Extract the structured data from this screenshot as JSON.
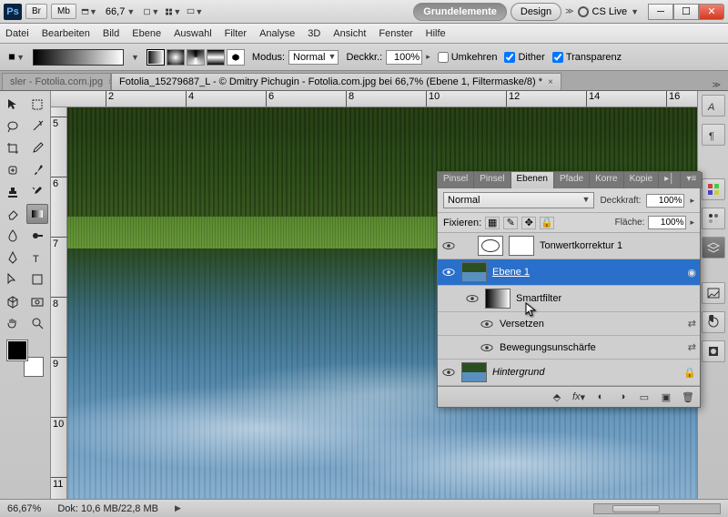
{
  "title": {
    "zoom": "66,7",
    "ws_active": "Grundelemente",
    "ws_other": "Design",
    "cslive": "CS Live"
  },
  "menu": [
    "Datei",
    "Bearbeiten",
    "Bild",
    "Ebene",
    "Auswahl",
    "Filter",
    "Analyse",
    "3D",
    "Ansicht",
    "Fenster",
    "Hilfe"
  ],
  "options": {
    "mode_label": "Modus:",
    "mode_value": "Normal",
    "opacity_label": "Deckkr.:",
    "opacity_value": "100%",
    "reverse": "Umkehren",
    "dither": "Dither",
    "trans": "Transparenz"
  },
  "tabs": {
    "inactive": "sler - Fotolia.com.jpg",
    "active": "Fotolia_15279687_L - © Dmitry Pichugin - Fotolia.com.jpg bei 66,7% (Ebene 1, Filtermaske/8) *"
  },
  "ruler_h": [
    "2",
    "4",
    "6",
    "8",
    "10",
    "12",
    "14",
    "16"
  ],
  "ruler_v": [
    "5",
    "6",
    "7",
    "8",
    "9",
    "10",
    "11"
  ],
  "panel": {
    "tabs": [
      "Pinsel",
      "Pinsel",
      "Ebenen",
      "Pfade",
      "Korre",
      "Kopie"
    ],
    "blend": "Normal",
    "opacity_label": "Deckkraft:",
    "opacity": "100%",
    "lock_label": "Fixieren:",
    "fill_label": "Fläche:",
    "fill": "100%",
    "layers": [
      {
        "name": "Tonwertkorrektur 1"
      },
      {
        "name": "Ebene 1"
      },
      {
        "name": "Smartfilter"
      },
      {
        "name": "Versetzen"
      },
      {
        "name": "Bewegungsunschärfe"
      },
      {
        "name": "Hintergrund"
      }
    ]
  },
  "status": {
    "zoom": "66,67%",
    "doc": "Dok: 10,6 MB/22,8 MB"
  }
}
